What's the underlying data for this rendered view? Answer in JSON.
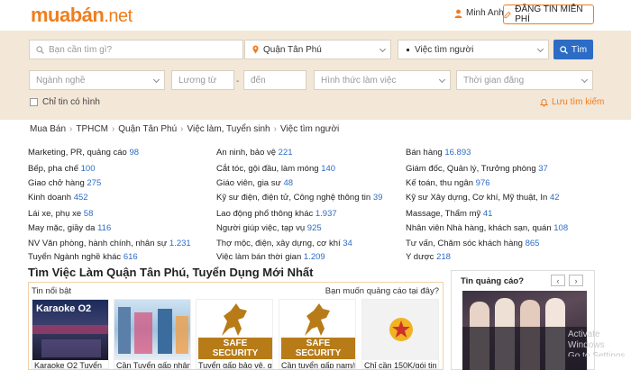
{
  "header": {
    "logo_part1": "muabán",
    "logo_part2": ".net",
    "user_name": "Minh Anh",
    "post_button": "ĐĂNG TIN MIỄN PHÍ"
  },
  "search": {
    "query_placeholder": "Bạn cần tìm gì?",
    "location": "Quận Tân Phú",
    "category": "Việc tìm người",
    "button": "Tìm",
    "field_occupation": "Ngành nghề",
    "salary_from": "Lương từ",
    "salary_to": "đến",
    "work_type": "Hình thức làm việc",
    "posted_time": "Thời gian đăng",
    "image_only": "Chỉ tin có hình",
    "save_search": "Lưu tìm kiếm"
  },
  "breadcrumb": [
    "Mua Bán",
    "TPHCM",
    "Quận Tân Phú",
    "Việc làm, Tuyển sinh",
    "Việc tìm người"
  ],
  "categories": [
    {
      "label": "Marketing, PR, quảng cáo",
      "count": "98"
    },
    {
      "label": "Bếp, pha chế",
      "count": "100"
    },
    {
      "label": "Giao chở hàng",
      "count": "275"
    },
    {
      "label": "Kinh doanh",
      "count": "452"
    },
    {
      "label": "Lái xe, phụ xe",
      "count": "58"
    },
    {
      "label": "May mặc, giầy da",
      "count": "116"
    },
    {
      "label": "NV Văn phòng, hành chính, nhân sự",
      "count": "1.231"
    },
    {
      "label": "Tuyển Ngành nghề khác",
      "count": "616"
    },
    {
      "label": "An ninh, bảo vệ",
      "count": "221"
    },
    {
      "label": "Cắt tóc, gội đầu, làm móng",
      "count": "140"
    },
    {
      "label": "Giáo viên, gia sư",
      "count": "48"
    },
    {
      "label": "Kỹ sư điện, điện tử, Công nghệ thông tin",
      "count": "39"
    },
    {
      "label": "Lao động phổ thông khác",
      "count": "1.937"
    },
    {
      "label": "Người giúp việc, tạp vụ",
      "count": "925"
    },
    {
      "label": "Thợ mộc, điện, xây dựng, cơ khí",
      "count": "34"
    },
    {
      "label": "Việc làm bán thời gian",
      "count": "1.209"
    },
    {
      "label": "Bán hàng",
      "count": "16.893"
    },
    {
      "label": "Giám đốc, Quản lý, Trưởng phòng",
      "count": "37"
    },
    {
      "label": "Kế toán, thu ngân",
      "count": "976"
    },
    {
      "label": "Kỹ sư Xây dựng, Cơ khí, Mỹ thuật, In",
      "count": "42"
    },
    {
      "label": "Massage, Thẩm mỹ",
      "count": "41"
    },
    {
      "label": "Nhân viên Nhà hàng, khách sạn, quán",
      "count": "108"
    },
    {
      "label": "Tư vấn, Chăm sóc khách hàng",
      "count": "865"
    },
    {
      "label": "Y dược",
      "count": "218"
    }
  ],
  "section_title": "Tìm Việc Làm Quận Tân Phú, Tuyển Dụng Mới Nhất",
  "featured": {
    "header": "Tin nổi bật",
    "ad_question": "Bạn muốn quảng cáo tại đây?",
    "items": [
      {
        "caption": "Karaoke O2 Tuyển",
        "image_text": "Karaoke O2"
      },
      {
        "caption": "Cần Tuyển gấp nhân"
      },
      {
        "caption": "Tuyển gấp bảo vệ, giữ",
        "image_text": "SAFE\nSECURITY"
      },
      {
        "caption": "Cần tuyển gấp nam/nữ bảo",
        "image_text": "SAFE\nSECURITY"
      },
      {
        "caption": "Chỉ cần 150K/gói tin"
      }
    ]
  },
  "ad": {
    "title": "Tin quảng cáo?",
    "prev": "‹",
    "next": "›"
  },
  "watermark": "Activate Windows\nGo to Settings to activate Windows.",
  "colors": {
    "accent": "#f07d1c",
    "link": "#2c6cc5",
    "search_bg": "#f3e7d7"
  }
}
